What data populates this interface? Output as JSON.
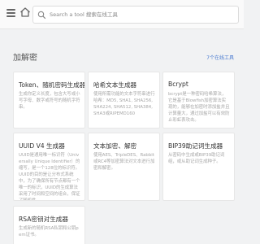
{
  "search": {
    "placeholder": "Search a tool 搜索在线工具"
  },
  "section": {
    "title": "加解密",
    "view_all": "7个在线工具"
  },
  "cards": [
    {
      "title": "Token、随机密码生成器",
      "desc": "生成你定义长度，包含大写或小写字母、数字或符号的随机字符串。"
    },
    {
      "title": "哈希文本生成器",
      "desc": "使用所需功能的文本字符串进行哈希：MD5, SHA1, SHA256, SHA224, SHA512, SHA384, SHA3或RIPEMD160"
    },
    {
      "title": "Bcrypt",
      "desc": "bcrypt是一种密码哈希算法，它是基于Blowfish加密算法实现的，能够在加密时添加盐并且计算量大，通过加盐可以有效防止彩虹表攻击。"
    },
    {
      "title": "UUID V4 生成器",
      "desc": "UUID是通用唯一标识符（Universally Unique Identifier）的缩写，是一个128位的标识符。UUID的目的是让分布式系统中，为了确保所有节点都有一个唯一的标识，UUID的生成算法采用了时间和空间的组合，保证了随机性。"
    },
    {
      "title": "文本加密、解密",
      "desc": "使用AES、TripleDES、Rabbit或RC4等加密算法对文本进行加密和解密。"
    },
    {
      "title": "BIP39助记词生成器",
      "desc": "从密码中生成或BIP39助记词组，或从助记词生成种子。"
    },
    {
      "title": "RSA密钥对生成器",
      "desc": "生成新的随机RSA私钥和公钥pem证书。"
    }
  ],
  "colors": {
    "background": "#f1f2f3",
    "card": "#ffffff",
    "link": "#4a7bd1"
  }
}
